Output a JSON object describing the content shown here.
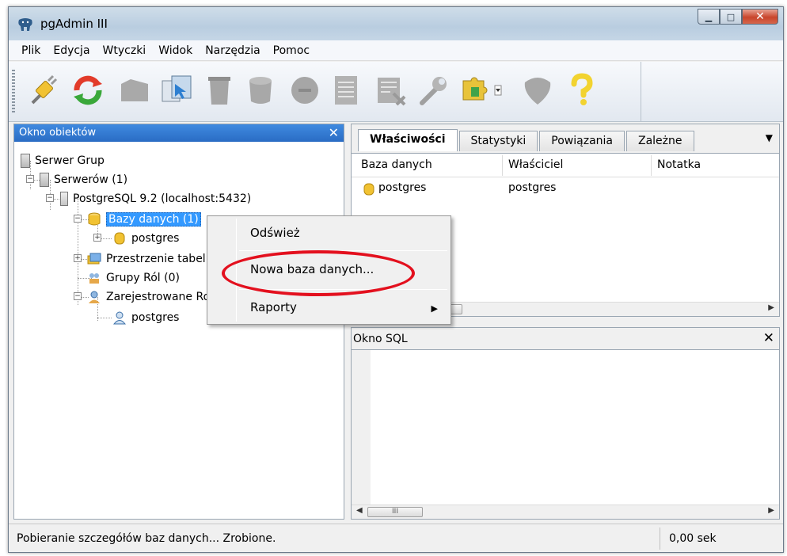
{
  "window": {
    "title": "pgAdmin III"
  },
  "menu": [
    "Plik",
    "Edycja",
    "Wtyczki",
    "Widok",
    "Narzędzia",
    "Pomoc"
  ],
  "toolbar_icons": [
    "connect-icon",
    "refresh-icon",
    "object-icon",
    "sql-query-icon",
    "delete-icon",
    "drop-icon",
    "properties-icon",
    "view-data-icon",
    "maintenance-icon",
    "plugins-icon",
    "hint-icon",
    "help-icon"
  ],
  "object_browser": {
    "title": "Okno obiektów",
    "close": "✕",
    "nodes": [
      {
        "label": "Serwer Grup"
      },
      {
        "label": "Serwerów (1)"
      },
      {
        "label": "PostgreSQL 9.2 (localhost:5432)"
      },
      {
        "label": "Bazy danych (1)"
      },
      {
        "label": "postgres"
      },
      {
        "label": "Przestrzenie tabel (2)"
      },
      {
        "label": "Grupy Ról (0)"
      },
      {
        "label": "Zarejestrowane Role (1)"
      },
      {
        "label": "postgres"
      }
    ]
  },
  "properties": {
    "tabs": [
      "Właściwości",
      "Statystyki",
      "Powiązania",
      "Zależne"
    ],
    "columns": [
      "Baza danych",
      "Właściciel",
      "Notatka"
    ],
    "rows": [
      {
        "name": "postgres",
        "owner": "postgres",
        "comment": ""
      }
    ]
  },
  "sql_pane": {
    "title": "Okno SQL",
    "close": "✕"
  },
  "context_menu": {
    "items": [
      "Odśwież",
      "Nowa baza danych...",
      "Raporty"
    ]
  },
  "status": {
    "message": "Pobieranie szczegółów baz danych... Zrobione.",
    "time": "0,00 sek"
  },
  "colors": {
    "selection": "#3399ff",
    "annotation": "#e3101e",
    "panel_header": "#2a6cc4"
  }
}
